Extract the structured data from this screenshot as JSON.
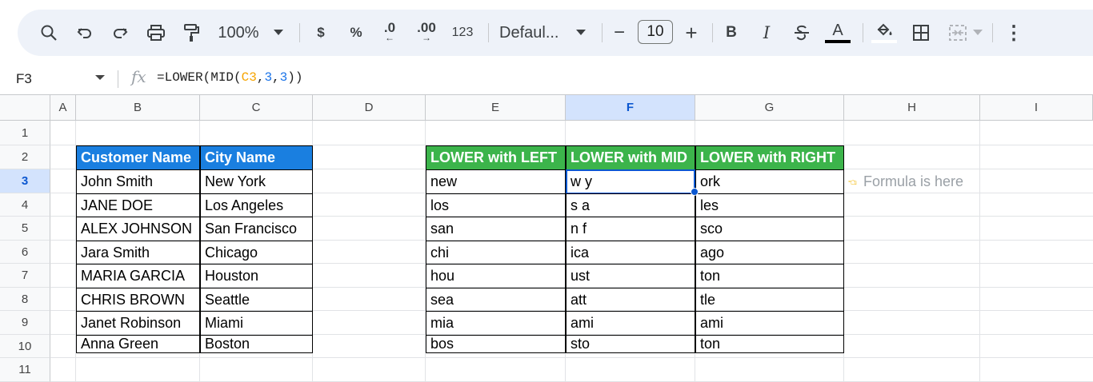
{
  "toolbar": {
    "zoom": "100%",
    "currency": "$",
    "percent": "%",
    "decrease_decimal": ".0",
    "increase_decimal": ".00",
    "number_format": "123",
    "font_family": "Defaul...",
    "font_size_minus": "−",
    "font_size": "10",
    "font_size_plus": "+",
    "bold": "B",
    "italic": "I",
    "text_color": "A",
    "more": "⋮"
  },
  "formula_bar": {
    "cell_ref": "F3",
    "formula_prefix": "=LOWER(MID(",
    "formula_ref": "C3",
    "formula_sep1": ",",
    "formula_num1": "3",
    "formula_sep2": ",",
    "formula_num2": "3",
    "formula_suffix": "))"
  },
  "columns": [
    "A",
    "B",
    "C",
    "D",
    "E",
    "F",
    "G",
    "H",
    "I"
  ],
  "rows": [
    "1",
    "2",
    "3",
    "4",
    "5",
    "6",
    "7",
    "8",
    "9",
    "10",
    "11"
  ],
  "selected": {
    "column": "F",
    "row": "3"
  },
  "source_table": {
    "headers": [
      "Customer Name",
      "City Name"
    ],
    "rows": [
      [
        "John Smith",
        "New York"
      ],
      [
        "JANE DOE",
        "Los Angeles"
      ],
      [
        "ALEX JOHNSON",
        "San Francisco"
      ],
      [
        "Jara Smith",
        "Chicago"
      ],
      [
        "MARIA GARCIA",
        "Houston"
      ],
      [
        "CHRIS BROWN",
        "Seattle"
      ],
      [
        "Janet Robinson",
        "Miami"
      ],
      [
        "Anna Green",
        "Boston"
      ]
    ]
  },
  "result_table": {
    "headers": [
      "LOWER with LEFT",
      "LOWER with MID",
      "LOWER with RIGHT"
    ],
    "rows": [
      [
        "new",
        "w y",
        "ork"
      ],
      [
        "los",
        "s a",
        "les"
      ],
      [
        "san",
        "n f",
        "sco"
      ],
      [
        "chi",
        "ica",
        "ago"
      ],
      [
        "hou",
        "ust",
        "ton"
      ],
      [
        "sea",
        "att",
        "tle"
      ],
      [
        "mia",
        "ami",
        "ami"
      ],
      [
        "bos",
        "sto",
        "ton"
      ]
    ]
  },
  "note": "Formula is here",
  "colors": {
    "header_blue": "#1a7fe0",
    "header_green": "#3cb44b",
    "selection": "#0b57d0",
    "toolbar_bg": "#eef2f9"
  },
  "icons": [
    "search-icon",
    "undo-icon",
    "redo-icon",
    "print-icon",
    "paint-format-icon",
    "strikethrough-icon",
    "fill-color-icon",
    "borders-icon",
    "merge-cells-icon",
    "pointing-hand-icon"
  ]
}
